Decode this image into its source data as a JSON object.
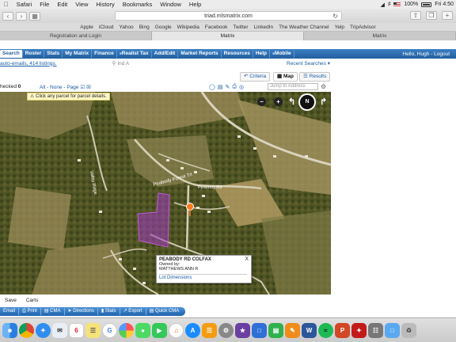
{
  "menubar": {
    "items": [
      "Safari",
      "File",
      "Edit",
      "View",
      "History",
      "Bookmarks",
      "Window",
      "Help"
    ],
    "battery": "100%",
    "clock": "Fri 4:50"
  },
  "browser": {
    "url": "triad.mlsmatrix.com",
    "favorites": [
      "Apple",
      "iCloud",
      "Yahoo",
      "Bing",
      "Google",
      "Wikipedia",
      "Facebook",
      "Twitter",
      "LinkedIn",
      "The Weather Channel",
      "Yelp",
      "TripAdvisor"
    ],
    "tabs": [
      "Registration and Login",
      "Matrix",
      "Matrix"
    ]
  },
  "nav": {
    "items": [
      "Search",
      "Roster",
      "Stats",
      "My Matrix",
      "Finance",
      "Realist Tax",
      "Add/Edit",
      "Market Reports",
      "Resources",
      "Help",
      "Mobile"
    ],
    "greeting": "Hello, Hugh - Logout"
  },
  "subbar": {
    "auto_emails": "auto-emails, 414 listings.",
    "find_placeholder": "Ind A",
    "recent": "Recent Searches"
  },
  "results": {
    "tabs": [
      "Criteria",
      "Map",
      "Results"
    ],
    "checked_label": "hecked",
    "checked_count": "0",
    "select_all": "All",
    "select_none": "None",
    "select_page": "Page",
    "jump_placeholder": "Jump to Address"
  },
  "map": {
    "hint": "Click any parcel for parcel details.",
    "compass": "N",
    "road_labels": [
      "Peabody Forest Trl",
      "Peabody Rd",
      "Valley Ridge"
    ],
    "popup": {
      "address": "PEABODY RD COLFAX",
      "owned_by_label": "Owned by:",
      "owner": "MATTHEWS ANN R",
      "link": "Lot Dimensions",
      "close": "X"
    }
  },
  "actions": {
    "save": "Save",
    "carts": "Carts",
    "buttons": [
      "Email",
      "Print",
      "CMA",
      "Directions",
      "Stats",
      "Export",
      "Quick CMA"
    ]
  },
  "dock": {
    "icons": [
      "finder-icon",
      "chrome-icon",
      "safari-icon",
      "mail-icon",
      "calendar-icon",
      "notes-icon",
      "google-icon",
      "photos-icon",
      "messages-icon",
      "facetime-icon",
      "itunes-icon",
      "appstore-icon",
      "ibooks-icon",
      "preferences-icon",
      "imovie-icon",
      "keynote-icon",
      "numbers-icon",
      "pages-icon",
      "word-icon",
      "spotify-icon",
      "powerpoint-icon",
      "acrobat-icon",
      "launchpad-icon",
      "folder-icon",
      "trash-icon"
    ],
    "calendar_day": "6"
  },
  "colors": {
    "nav_blue": "#235f9e",
    "link_blue": "#1a5ca8",
    "parcel_highlight": "#a13bbf",
    "pin": "#ff7a1a"
  }
}
